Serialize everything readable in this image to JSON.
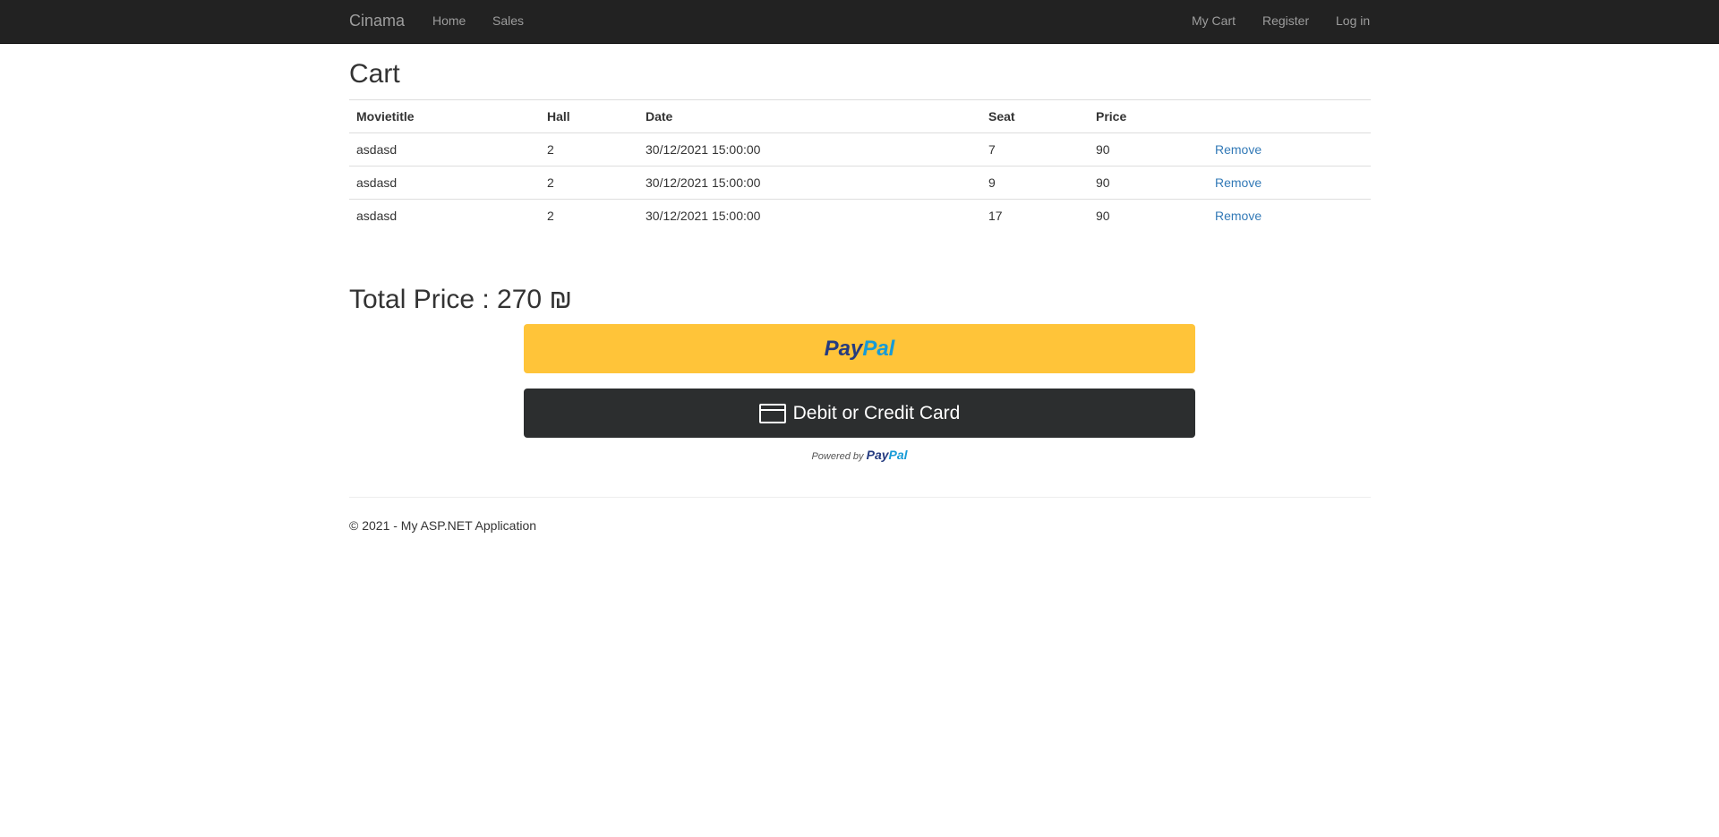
{
  "navbar": {
    "brand": "Cinama",
    "left_links": [
      "Home",
      "Sales"
    ],
    "right_links": [
      "My Cart",
      "Register",
      "Log in"
    ]
  },
  "page": {
    "title": "Cart"
  },
  "cart": {
    "headers": [
      "Movietitle",
      "Hall",
      "Date",
      "Seat",
      "Price",
      ""
    ],
    "rows": [
      {
        "title": "asdasd",
        "hall": "2",
        "date": "30/12/2021 15:00:00",
        "seat": "7",
        "price": "90",
        "action": "Remove"
      },
      {
        "title": "asdasd",
        "hall": "2",
        "date": "30/12/2021 15:00:00",
        "seat": "9",
        "price": "90",
        "action": "Remove"
      },
      {
        "title": "asdasd",
        "hall": "2",
        "date": "30/12/2021 15:00:00",
        "seat": "17",
        "price": "90",
        "action": "Remove"
      }
    ]
  },
  "total": {
    "label": "Total Price : 270 ₪"
  },
  "payment": {
    "paypal_pay": "Pay",
    "paypal_pal": "Pal",
    "card_label": "Debit or Credit Card",
    "powered_by": "Powered by",
    "card_icon": "credit-card-icon"
  },
  "footer": {
    "text": "© 2021 - My ASP.NET Application"
  },
  "colors": {
    "navbar_bg": "#222222",
    "paypal_yellow": "#ffc439",
    "card_dark": "#2c2e2f",
    "link_blue": "#337ab7"
  }
}
